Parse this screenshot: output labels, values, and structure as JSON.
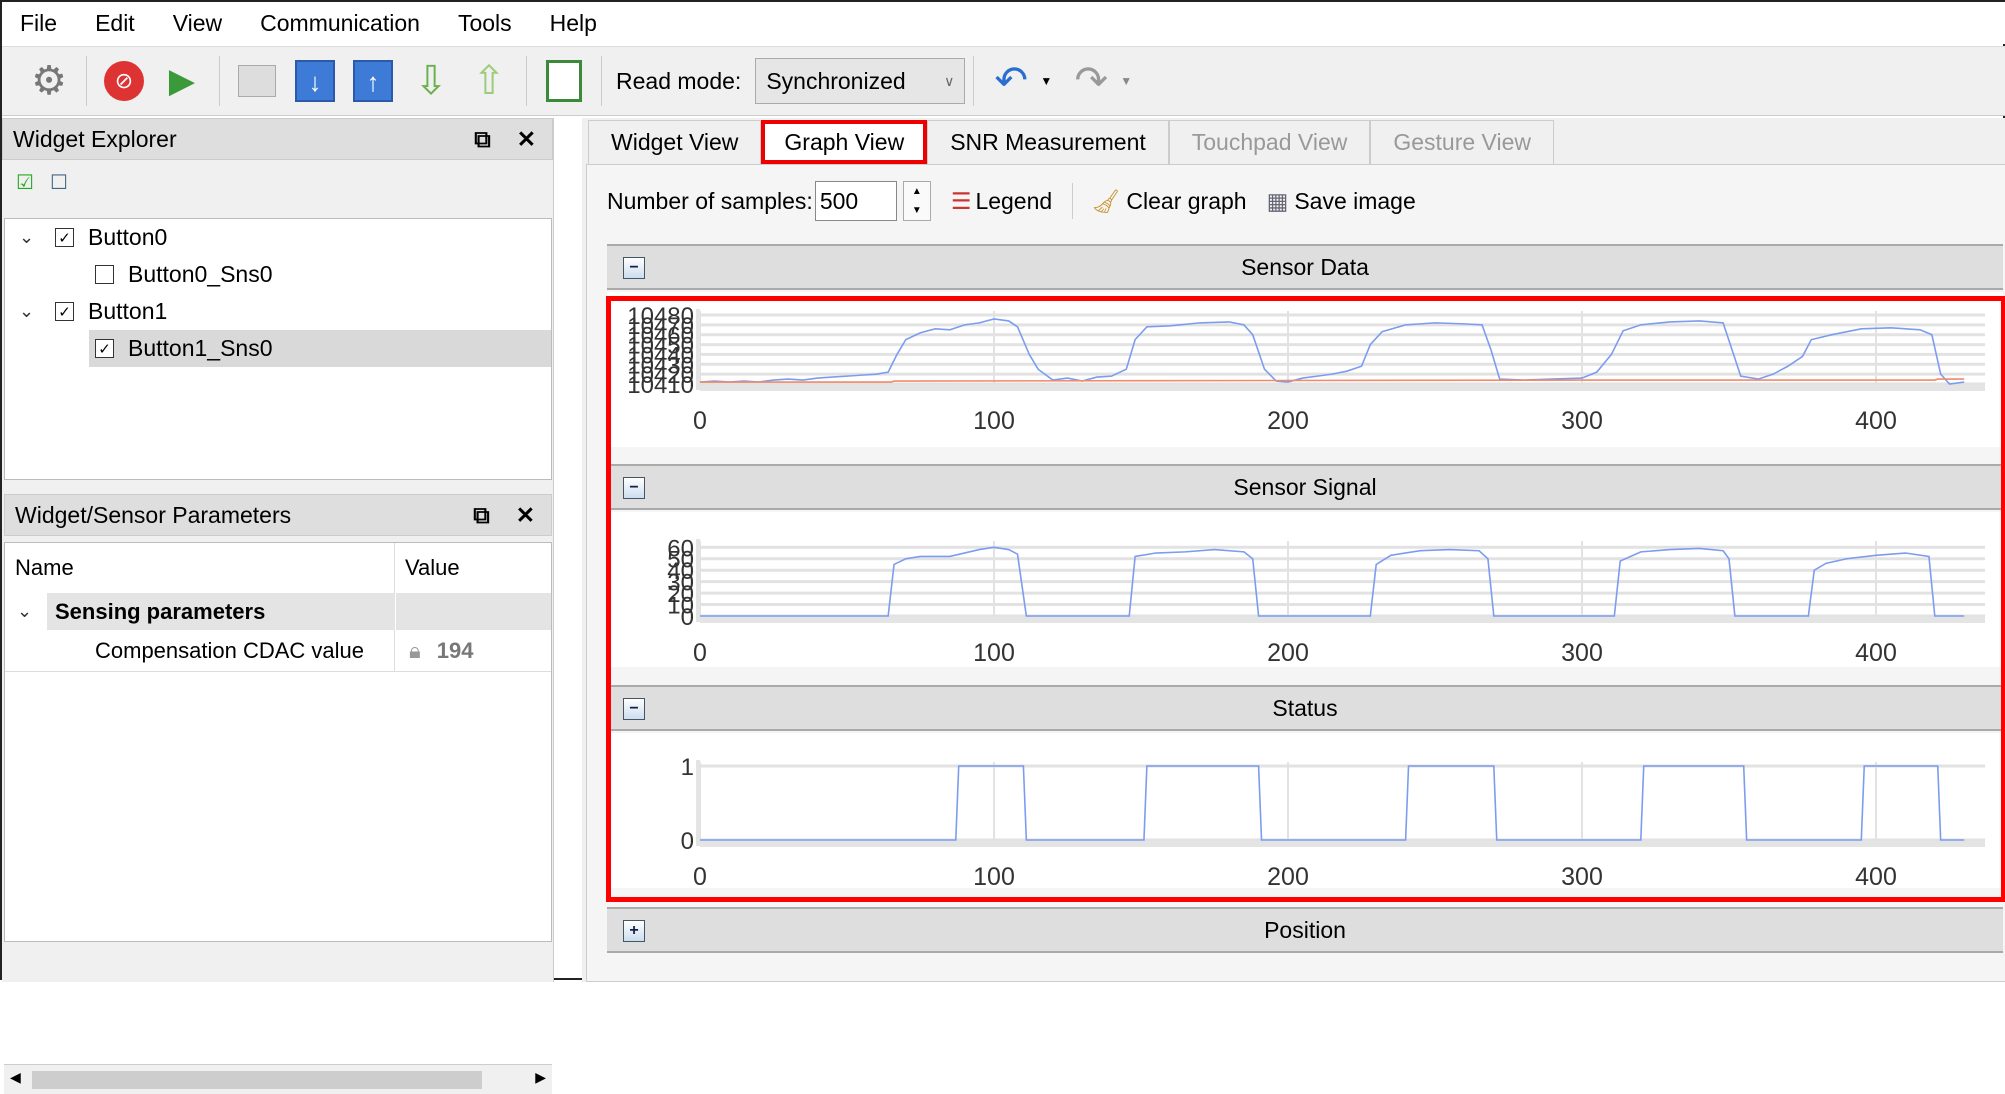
{
  "menu": [
    "File",
    "Edit",
    "View",
    "Communication",
    "Tools",
    "Help"
  ],
  "toolbar": {
    "read_mode_label": "Read mode:",
    "read_mode_value": "Synchronized",
    "icons": [
      "gear-icon",
      "stop-icon",
      "play-icon",
      "open-folder-icon",
      "download-icon",
      "upload-icon",
      "read-icon",
      "write-icon",
      "log-icon",
      "undo-icon",
      "redo-icon"
    ]
  },
  "widget_explorer": {
    "title": "Widget Explorer",
    "tree": [
      {
        "label": "Button0",
        "checked": true,
        "children": [
          {
            "label": "Button0_Sns0",
            "checked": false
          }
        ]
      },
      {
        "label": "Button1",
        "checked": true,
        "children": [
          {
            "label": "Button1_Sns0",
            "checked": true,
            "selected": true
          }
        ]
      }
    ]
  },
  "parameters": {
    "title": "Widget/Sensor Parameters",
    "col_name": "Name",
    "col_value": "Value",
    "group": "Sensing parameters",
    "rows": [
      {
        "name": "Compensation CDAC value",
        "value": "194",
        "locked": true
      }
    ]
  },
  "tabs": [
    {
      "label": "Widget View",
      "enabled": true
    },
    {
      "label": "Graph View",
      "enabled": true,
      "selected": true
    },
    {
      "label": "SNR Measurement",
      "enabled": true
    },
    {
      "label": "Touchpad View",
      "enabled": false
    },
    {
      "label": "Gesture View",
      "enabled": false
    }
  ],
  "graph_toolbar": {
    "samples_label": "Number of samples:",
    "samples_value": "500",
    "legend": "Legend",
    "clear": "Clear graph",
    "save": "Save image"
  },
  "colors": {
    "signal": "#7b9cf0",
    "baseline": "#f08a6a",
    "highlight": "#ff0000"
  },
  "chart_data": [
    {
      "title": "Sensor Data",
      "type": "line",
      "expanded": true,
      "xlim": [
        0,
        430
      ],
      "ylim": [
        10410,
        10480
      ],
      "xticks": [
        0,
        100,
        200,
        300,
        400
      ],
      "yticks": [
        10410,
        10420,
        10430,
        10440,
        10450,
        10460,
        10470,
        10480
      ],
      "grid": true,
      "series": [
        {
          "color": "#7b9cf0",
          "points": [
            [
              0,
              10412
            ],
            [
              5,
              10413
            ],
            [
              10,
              10412
            ],
            [
              15,
              10413
            ],
            [
              20,
              10412
            ],
            [
              25,
              10414
            ],
            [
              30,
              10415
            ],
            [
              35,
              10414
            ],
            [
              40,
              10416
            ],
            [
              45,
              10417
            ],
            [
              50,
              10418
            ],
            [
              55,
              10419
            ],
            [
              60,
              10420
            ],
            [
              64,
              10422
            ],
            [
              67,
              10440
            ],
            [
              70,
              10455
            ],
            [
              75,
              10462
            ],
            [
              80,
              10466
            ],
            [
              85,
              10465
            ],
            [
              90,
              10470
            ],
            [
              95,
              10472
            ],
            [
              100,
              10476
            ],
            [
              105,
              10474
            ],
            [
              108,
              10468
            ],
            [
              112,
              10440
            ],
            [
              115,
              10425
            ],
            [
              120,
              10414
            ],
            [
              125,
              10416
            ],
            [
              130,
              10413
            ],
            [
              135,
              10417
            ],
            [
              140,
              10418
            ],
            [
              145,
              10425
            ],
            [
              148,
              10455
            ],
            [
              152,
              10468
            ],
            [
              160,
              10469
            ],
            [
              170,
              10472
            ],
            [
              180,
              10473
            ],
            [
              185,
              10470
            ],
            [
              188,
              10460
            ],
            [
              192,
              10425
            ],
            [
              196,
              10413
            ],
            [
              200,
              10412
            ],
            [
              205,
              10416
            ],
            [
              210,
              10418
            ],
            [
              215,
              10420
            ],
            [
              220,
              10423
            ],
            [
              225,
              10428
            ],
            [
              228,
              10450
            ],
            [
              232,
              10463
            ],
            [
              240,
              10470
            ],
            [
              250,
              10472
            ],
            [
              260,
              10471
            ],
            [
              266,
              10470
            ],
            [
              269,
              10445
            ],
            [
              272,
              10415
            ],
            [
              280,
              10414
            ],
            [
              290,
              10415
            ],
            [
              300,
              10416
            ],
            [
              305,
              10422
            ],
            [
              310,
              10440
            ],
            [
              314,
              10464
            ],
            [
              320,
              10470
            ],
            [
              330,
              10473
            ],
            [
              340,
              10474
            ],
            [
              348,
              10472
            ],
            [
              351,
              10445
            ],
            [
              354,
              10418
            ],
            [
              360,
              10415
            ],
            [
              365,
              10420
            ],
            [
              370,
              10428
            ],
            [
              375,
              10438
            ],
            [
              378,
              10455
            ],
            [
              385,
              10460
            ],
            [
              395,
              10466
            ],
            [
              405,
              10467
            ],
            [
              415,
              10465
            ],
            [
              419,
              10460
            ],
            [
              422,
              10420
            ],
            [
              425,
              10410
            ],
            [
              430,
              10412
            ]
          ]
        },
        {
          "color": "#f08a6a",
          "points": [
            [
              0,
              10412
            ],
            [
              65,
              10412
            ],
            [
              66,
              10413
            ],
            [
              300,
              10414
            ],
            [
              420,
              10414
            ],
            [
              421,
              10415
            ],
            [
              430,
              10415
            ]
          ]
        }
      ]
    },
    {
      "title": "Sensor Signal",
      "type": "line",
      "expanded": true,
      "xlim": [
        0,
        430
      ],
      "ylim": [
        0,
        62
      ],
      "xticks": [
        0,
        100,
        200,
        300,
        400
      ],
      "yticks": [
        0,
        10,
        20,
        30,
        40,
        50,
        60
      ],
      "grid": true,
      "series": [
        {
          "color": "#7b9cf0",
          "points": [
            [
              0,
              0
            ],
            [
              64,
              0
            ],
            [
              66,
              45
            ],
            [
              70,
              50
            ],
            [
              75,
              52
            ],
            [
              85,
              52
            ],
            [
              95,
              58
            ],
            [
              100,
              60
            ],
            [
              105,
              58
            ],
            [
              108,
              54
            ],
            [
              111,
              0
            ],
            [
              146,
              0
            ],
            [
              148,
              52
            ],
            [
              155,
              55
            ],
            [
              165,
              56
            ],
            [
              175,
              58
            ],
            [
              185,
              56
            ],
            [
              188,
              50
            ],
            [
              190,
              0
            ],
            [
              228,
              0
            ],
            [
              230,
              45
            ],
            [
              235,
              53
            ],
            [
              245,
              57
            ],
            [
              255,
              58
            ],
            [
              265,
              57
            ],
            [
              268,
              50
            ],
            [
              270,
              0
            ],
            [
              311,
              0
            ],
            [
              313,
              48
            ],
            [
              320,
              56
            ],
            [
              330,
              58
            ],
            [
              340,
              59
            ],
            [
              348,
              57
            ],
            [
              350,
              50
            ],
            [
              352,
              0
            ],
            [
              377,
              0
            ],
            [
              379,
              40
            ],
            [
              383,
              46
            ],
            [
              390,
              50
            ],
            [
              400,
              53
            ],
            [
              410,
              55
            ],
            [
              418,
              52
            ],
            [
              420,
              0
            ],
            [
              430,
              0
            ]
          ]
        }
      ]
    },
    {
      "title": "Status",
      "type": "line",
      "expanded": true,
      "xlim": [
        0,
        430
      ],
      "ylim": [
        0,
        1
      ],
      "xticks": [
        0,
        100,
        200,
        300,
        400
      ],
      "yticks": [
        0,
        1
      ],
      "grid": true,
      "series": [
        {
          "color": "#7b9cf0",
          "points": [
            [
              0,
              0
            ],
            [
              87,
              0
            ],
            [
              88,
              1
            ],
            [
              110,
              1
            ],
            [
              111,
              0
            ],
            [
              151,
              0
            ],
            [
              152,
              1
            ],
            [
              190,
              1
            ],
            [
              191,
              0
            ],
            [
              240,
              0
            ],
            [
              241,
              1
            ],
            [
              270,
              1
            ],
            [
              271,
              0
            ],
            [
              320,
              0
            ],
            [
              321,
              1
            ],
            [
              355,
              1
            ],
            [
              356,
              0
            ],
            [
              395,
              0
            ],
            [
              396,
              1
            ],
            [
              421,
              1
            ],
            [
              422,
              0
            ],
            [
              430,
              0
            ]
          ]
        }
      ]
    },
    {
      "title": "Position",
      "expanded": false
    }
  ]
}
